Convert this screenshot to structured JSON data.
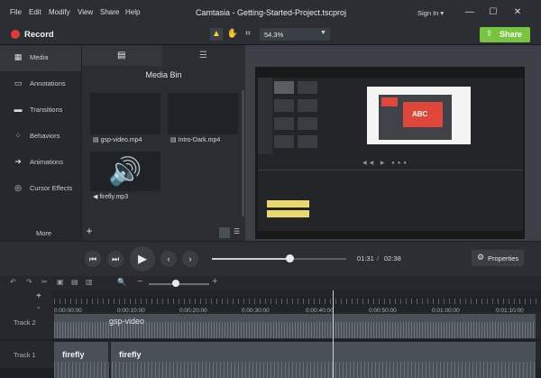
{
  "menu": {
    "items": [
      "File",
      "Edit",
      "Modify",
      "View",
      "Share",
      "Help"
    ]
  },
  "window": {
    "title": "Camtasia - Getting-Started-Project.tscproj",
    "signin": "Sign In ▾",
    "min": "—",
    "max": "☐",
    "close": "✕"
  },
  "toolbar": {
    "record": "Record",
    "zoom": "54.3%",
    "share": "Share"
  },
  "tools": {
    "items": [
      {
        "label": "Media",
        "icon": "film-icon"
      },
      {
        "label": "Annotations",
        "icon": "annotation-icon"
      },
      {
        "label": "Transitions",
        "icon": "transition-icon"
      },
      {
        "label": "Behaviors",
        "icon": "behavior-icon"
      },
      {
        "label": "Animations",
        "icon": "animation-icon"
      },
      {
        "label": "Cursor Effects",
        "icon": "cursor-icon"
      }
    ],
    "more": "More",
    "add": "+"
  },
  "media_bin": {
    "title": "Media Bin",
    "items": [
      {
        "label": "gsp-video.mp4"
      },
      {
        "label": "Intro-Dark.mp4"
      },
      {
        "label": "firefly.mp3"
      }
    ]
  },
  "canvas": {
    "preview_text": "ABC"
  },
  "playback": {
    "current": "01:31",
    "sep": "/",
    "total": "02:38",
    "properties": "Properties",
    "progress": 0.58
  },
  "timeline": {
    "ticks": [
      "0:00:00;00",
      "0:00:10;00",
      "0:00:20;00",
      "0:00:30;00",
      "0:00:40;00",
      "0:00:50;00",
      "0:01:00;00",
      "0:01:10;00"
    ],
    "tracks": [
      {
        "label": "Track 2",
        "clips": [
          "gsp-video"
        ]
      },
      {
        "label": "Track 1",
        "clips": [
          "firefly",
          "firefly"
        ]
      }
    ]
  }
}
